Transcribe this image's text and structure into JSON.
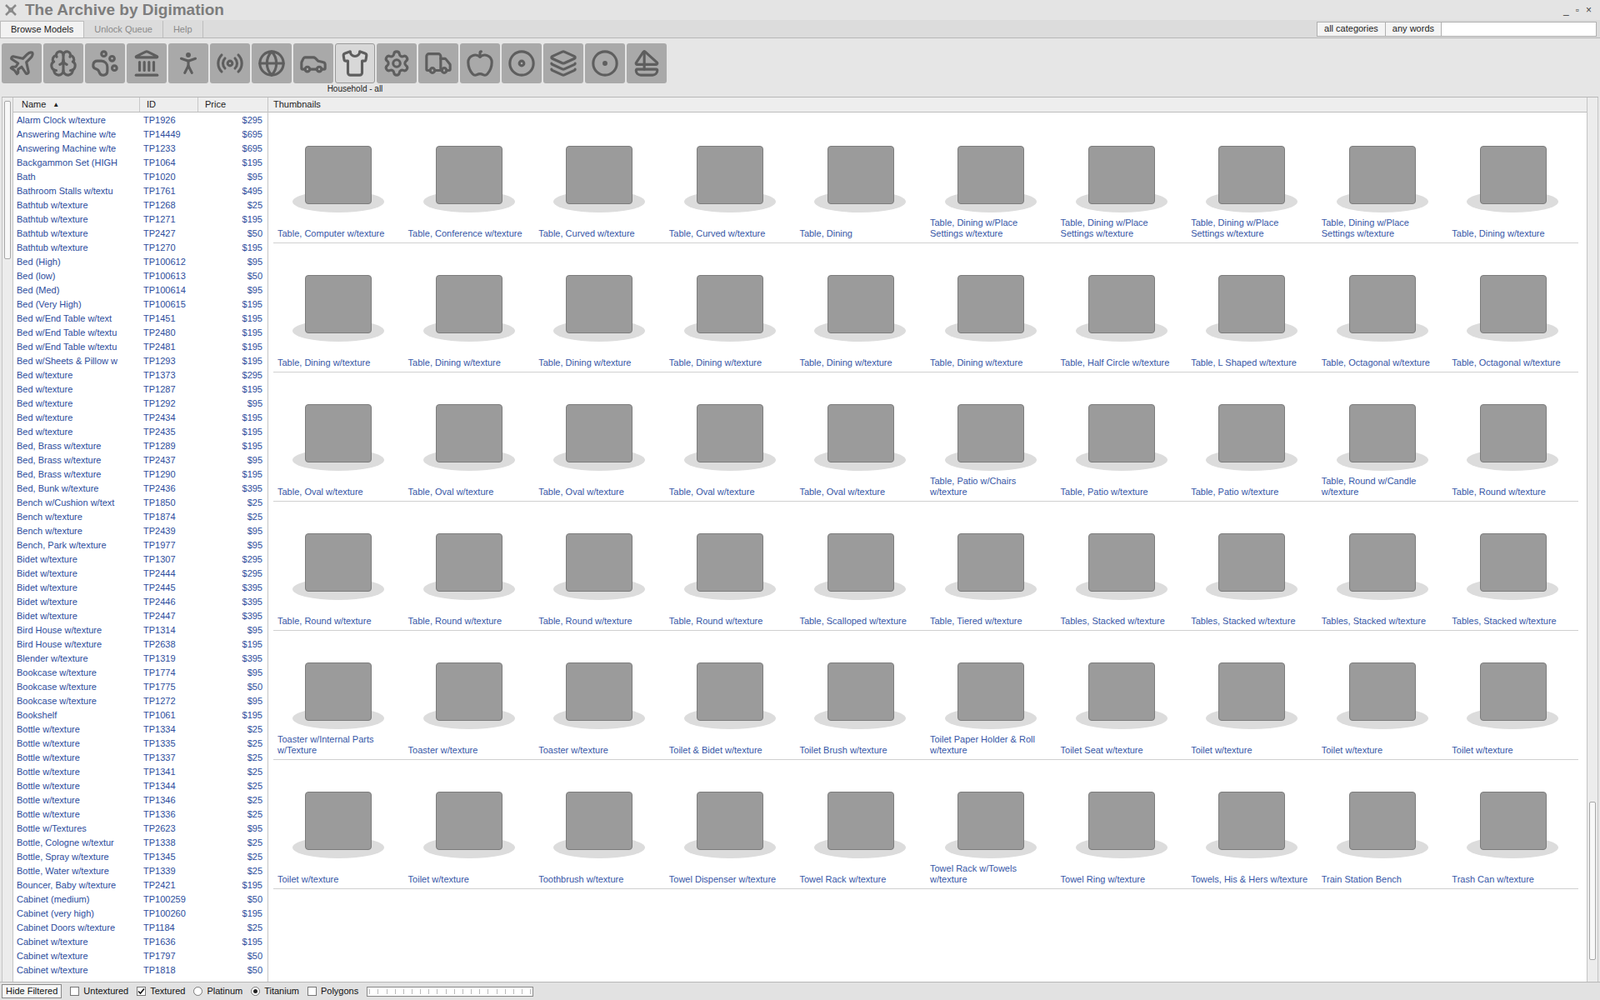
{
  "window": {
    "title": "The Archive by Digimation",
    "controls": [
      "_",
      "▫",
      "×"
    ]
  },
  "tabs": [
    {
      "label": "Browse Models",
      "selected": true
    },
    {
      "label": "Unlock Queue",
      "selected": false
    },
    {
      "label": "Help",
      "selected": false
    }
  ],
  "search": {
    "category": "all categories",
    "mode": "any words",
    "value": ""
  },
  "categories": {
    "current_label": "Household - all",
    "items": [
      {
        "selected": false
      },
      {
        "selected": false
      },
      {
        "selected": false
      },
      {
        "selected": false
      },
      {
        "selected": false
      },
      {
        "selected": false
      },
      {
        "selected": false
      },
      {
        "selected": false
      },
      {
        "selected": true
      },
      {
        "selected": false
      },
      {
        "selected": false
      },
      {
        "selected": false
      },
      {
        "selected": false
      },
      {
        "selected": false
      },
      {
        "selected": false
      },
      {
        "selected": false
      }
    ]
  },
  "list": {
    "columns": [
      "Name",
      "ID",
      "Price"
    ],
    "sort_indicator": "▲",
    "rows": [
      {
        "name": "Alarm Clock w/texture",
        "id": "TP1926",
        "price": "$295"
      },
      {
        "name": "Answering Machine w/te",
        "id": "TP14449",
        "price": "$695"
      },
      {
        "name": "Answering Machine w/te",
        "id": "TP1233",
        "price": "$695"
      },
      {
        "name": "Backgammon Set (HIGH",
        "id": "TP1064",
        "price": "$195"
      },
      {
        "name": "Bath",
        "id": "TP1020",
        "price": "$95"
      },
      {
        "name": "Bathroom Stalls w/textu",
        "id": "TP1761",
        "price": "$495"
      },
      {
        "name": "Bathtub w/texture",
        "id": "TP1268",
        "price": "$25"
      },
      {
        "name": "Bathtub w/texture",
        "id": "TP1271",
        "price": "$195"
      },
      {
        "name": "Bathtub w/texture",
        "id": "TP2427",
        "price": "$50"
      },
      {
        "name": "Bathtub w/texture",
        "id": "TP1270",
        "price": "$195"
      },
      {
        "name": "Bed (High)",
        "id": "TP100612",
        "price": "$95"
      },
      {
        "name": "Bed (low)",
        "id": "TP100613",
        "price": "$50"
      },
      {
        "name": "Bed (Med)",
        "id": "TP100614",
        "price": "$95"
      },
      {
        "name": "Bed (Very High)",
        "id": "TP100615",
        "price": "$195"
      },
      {
        "name": "Bed w/End Table w/text",
        "id": "TP1451",
        "price": "$195"
      },
      {
        "name": "Bed w/End Table w/textu",
        "id": "TP2480",
        "price": "$195"
      },
      {
        "name": "Bed w/End Table w/textu",
        "id": "TP2481",
        "price": "$195"
      },
      {
        "name": "Bed w/Sheets & Pillow w",
        "id": "TP1293",
        "price": "$195"
      },
      {
        "name": "Bed w/texture",
        "id": "TP1373",
        "price": "$295"
      },
      {
        "name": "Bed w/texture",
        "id": "TP1287",
        "price": "$195"
      },
      {
        "name": "Bed w/texture",
        "id": "TP1292",
        "price": "$95"
      },
      {
        "name": "Bed w/texture",
        "id": "TP2434",
        "price": "$195"
      },
      {
        "name": "Bed w/texture",
        "id": "TP2435",
        "price": "$195"
      },
      {
        "name": "Bed, Brass w/texture",
        "id": "TP1289",
        "price": "$195"
      },
      {
        "name": "Bed, Brass w/texture",
        "id": "TP2437",
        "price": "$95"
      },
      {
        "name": "Bed, Brass w/texture",
        "id": "TP1290",
        "price": "$195"
      },
      {
        "name": "Bed, Bunk w/texture",
        "id": "TP2436",
        "price": "$395"
      },
      {
        "name": "Bench w/Cushion w/text",
        "id": "TP1850",
        "price": "$25"
      },
      {
        "name": "Bench w/texture",
        "id": "TP1874",
        "price": "$25"
      },
      {
        "name": "Bench w/texture",
        "id": "TP2439",
        "price": "$95"
      },
      {
        "name": "Bench, Park w/texture",
        "id": "TP1977",
        "price": "$95"
      },
      {
        "name": "Bidet w/texture",
        "id": "TP1307",
        "price": "$295"
      },
      {
        "name": "Bidet w/texture",
        "id": "TP2444",
        "price": "$295"
      },
      {
        "name": "Bidet w/texture",
        "id": "TP2445",
        "price": "$395"
      },
      {
        "name": "Bidet w/texture",
        "id": "TP2446",
        "price": "$395"
      },
      {
        "name": "Bidet w/texture",
        "id": "TP2447",
        "price": "$395"
      },
      {
        "name": "Bird House w/texture",
        "id": "TP1314",
        "price": "$95"
      },
      {
        "name": "Bird House w/texture",
        "id": "TP2638",
        "price": "$195"
      },
      {
        "name": "Blender w/texture",
        "id": "TP1319",
        "price": "$395"
      },
      {
        "name": "Bookcase w/texture",
        "id": "TP1774",
        "price": "$95"
      },
      {
        "name": "Bookcase w/texture",
        "id": "TP1775",
        "price": "$50"
      },
      {
        "name": "Bookcase w/texture",
        "id": "TP1272",
        "price": "$95"
      },
      {
        "name": "Bookshelf",
        "id": "TP1061",
        "price": "$195"
      },
      {
        "name": "Bottle w/texture",
        "id": "TP1334",
        "price": "$25"
      },
      {
        "name": "Bottle w/texture",
        "id": "TP1335",
        "price": "$25"
      },
      {
        "name": "Bottle w/texture",
        "id": "TP1337",
        "price": "$25"
      },
      {
        "name": "Bottle w/texture",
        "id": "TP1341",
        "price": "$25"
      },
      {
        "name": "Bottle w/texture",
        "id": "TP1344",
        "price": "$25"
      },
      {
        "name": "Bottle w/texture",
        "id": "TP1346",
        "price": "$25"
      },
      {
        "name": "Bottle w/texture",
        "id": "TP1336",
        "price": "$25"
      },
      {
        "name": "Bottle w/Textures",
        "id": "TP2623",
        "price": "$95"
      },
      {
        "name": "Bottle, Cologne w/textur",
        "id": "TP1338",
        "price": "$25"
      },
      {
        "name": "Bottle, Spray w/texture",
        "id": "TP1345",
        "price": "$25"
      },
      {
        "name": "Bottle, Water w/texture",
        "id": "TP1339",
        "price": "$25"
      },
      {
        "name": "Bouncer, Baby w/texture",
        "id": "TP2421",
        "price": "$195"
      },
      {
        "name": "Cabinet (medium)",
        "id": "TP100259",
        "price": "$50"
      },
      {
        "name": "Cabinet (very high)",
        "id": "TP100260",
        "price": "$195"
      },
      {
        "name": "Cabinet Doors w/texture",
        "id": "TP1184",
        "price": "$25"
      },
      {
        "name": "Cabinet w/texture",
        "id": "TP1636",
        "price": "$195"
      },
      {
        "name": "Cabinet w/texture",
        "id": "TP1797",
        "price": "$50"
      },
      {
        "name": "Cabinet w/texture",
        "id": "TP1818",
        "price": "$50"
      }
    ]
  },
  "thumbnails": {
    "header": "Thumbnails",
    "rows": [
      [
        "Table, Computer w/texture",
        "Table, Conference w/texture",
        "Table, Curved w/texture",
        "Table, Curved w/texture",
        "Table, Dining",
        "Table, Dining w/Place Settings w/texture",
        "Table, Dining w/Place Settings w/texture",
        "Table, Dining w/Place Settings w/texture",
        "Table, Dining w/Place Settings w/texture",
        "Table, Dining w/texture"
      ],
      [
        "Table, Dining w/texture",
        "Table, Dining w/texture",
        "Table, Dining w/texture",
        "Table, Dining w/texture",
        "Table, Dining w/texture",
        "Table, Dining w/texture",
        "Table, Half Circle w/texture",
        "Table, L Shaped w/texture",
        "Table, Octagonal w/texture",
        "Table, Octagonal w/texture"
      ],
      [
        "Table, Oval w/texture",
        "Table, Oval w/texture",
        "Table, Oval w/texture",
        "Table, Oval w/texture",
        "Table, Oval w/texture",
        "Table, Patio w/Chairs w/texture",
        "Table, Patio w/texture",
        "Table, Patio w/texture",
        "Table, Round w/Candle w/texture",
        "Table, Round w/texture"
      ],
      [
        "Table, Round w/texture",
        "Table, Round w/texture",
        "Table, Round w/texture",
        "Table, Round w/texture",
        "Table, Scalloped w/texture",
        "Table, Tiered w/texture",
        "Tables, Stacked w/texture",
        "Tables, Stacked w/texture",
        "Tables, Stacked w/texture",
        "Tables, Stacked w/texture"
      ],
      [
        "Toaster w/Internal Parts w/Texture",
        "Toaster w/texture",
        "Toaster w/texture",
        "Toilet & Bidet w/texture",
        "Toilet Brush w/texture",
        "Toilet Paper Holder & Roll w/texture",
        "Toilet Seat w/texture",
        "Toilet w/texture",
        "Toilet w/texture",
        "Toilet w/texture"
      ],
      [
        "Toilet w/texture",
        "Toilet w/texture",
        "Toothbrush w/texture",
        "Towel Dispenser w/texture",
        "Towel Rack w/texture",
        "Towel Rack w/Towels w/texture",
        "Towel Ring w/texture",
        "Towels, His & Hers w/texture",
        "Train Station Bench",
        "Trash Can w/texture"
      ]
    ]
  },
  "status_bar": {
    "button": "Hide Filtered",
    "filters": [
      {
        "label": "Untextured",
        "kind": "checkbox",
        "checked": false
      },
      {
        "label": "Textured",
        "kind": "checkbox",
        "checked": true
      },
      {
        "label": "Platinum",
        "kind": "radio",
        "checked": false
      },
      {
        "label": "Titanium",
        "kind": "radio",
        "checked": true
      },
      {
        "label": "Polygons",
        "kind": "checkbox",
        "checked": false
      }
    ],
    "progress": {
      "level": 0
    }
  }
}
